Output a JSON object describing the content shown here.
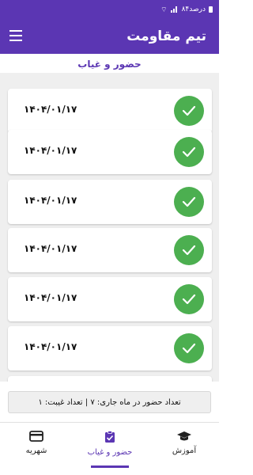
{
  "status_bar": {
    "battery_text": "۸۴درصد"
  },
  "app_bar": {
    "title": "تیم مقاومت",
    "menu_icon": "hamburger-menu-icon"
  },
  "section": {
    "title": "حضور و غیاب"
  },
  "attendance": {
    "records": [
      {
        "date": "۱۴۰۴/۰۱/۱۷",
        "status": "present"
      },
      {
        "date": "۱۴۰۴/۰۱/۱۷",
        "status": "present"
      },
      {
        "date": "۱۴۰۴/۰۱/۱۷",
        "status": "present"
      },
      {
        "date": "۱۴۰۴/۰۱/۱۷",
        "status": "present"
      },
      {
        "date": "۱۴۰۴/۰۱/۱۷",
        "status": "present"
      },
      {
        "date": "۱۴۰۴/۰۱/۱۷",
        "status": "present"
      }
    ]
  },
  "summary": {
    "text": "تعداد حضور در ماه جاری: ۷ | تعداد غیبت: ۱"
  },
  "bottom_nav": {
    "items": [
      {
        "label": "شهریه",
        "icon": "credit-card-icon"
      },
      {
        "label": "حضور و غیاب",
        "icon": "clipboard-check-icon"
      },
      {
        "label": "آموزش",
        "icon": "graduation-cap-icon"
      }
    ]
  },
  "colors": {
    "primary": "#5b36b3",
    "success": "#4caf50",
    "list_background": "#efefef"
  }
}
